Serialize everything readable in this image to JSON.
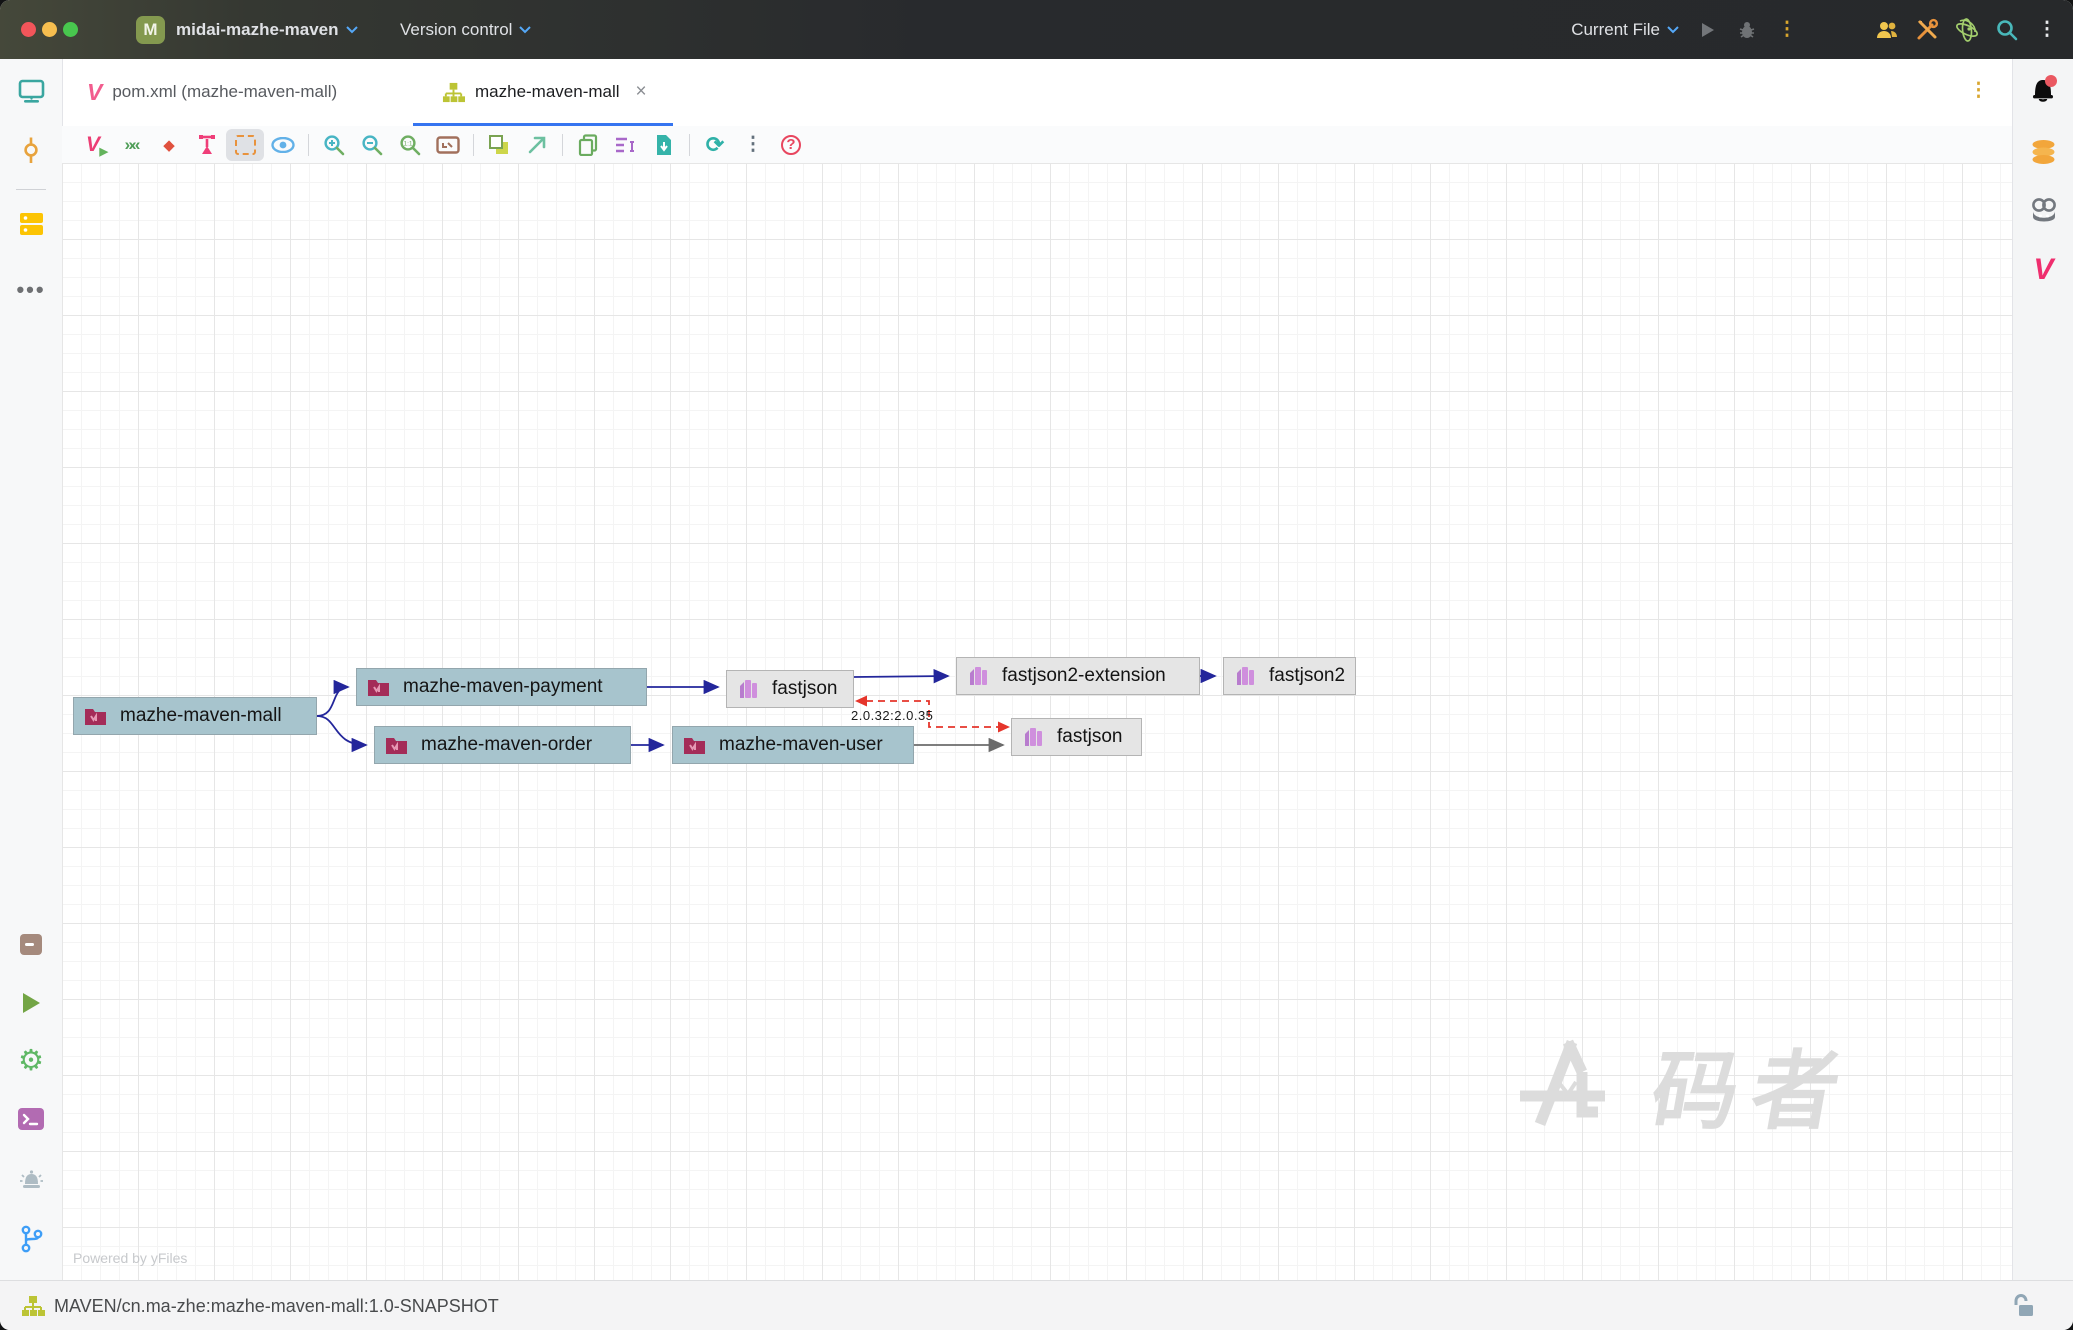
{
  "titlebar": {
    "project_initial": "M",
    "project_name": "midai-mazhe-maven",
    "vcs_label": "Version control",
    "run_config_label": "Current File",
    "icons": [
      "play-icon",
      "debug-bug-icon",
      "more-kebab-icon",
      "users-icon",
      "tools-icon",
      "atom-plugin-icon",
      "search-icon",
      "kebab-icon"
    ]
  },
  "tabs": [
    {
      "label": "pom.xml (mazhe-maven-mall)",
      "icon": "maven-v-icon",
      "active": false
    },
    {
      "label": "mazhe-maven-mall",
      "icon": "module-graph-icon",
      "active": true,
      "close": "×"
    }
  ],
  "toolbar_icons": [
    "maven-reimport-icon",
    "collapse-all-icon",
    "diamond-icon",
    "pin-layout-icon",
    "grid-snap-icon",
    "visibility-eye-icon",
    "zoom-in-icon",
    "zoom-out-icon",
    "zoom-reset-icon",
    "fit-content-icon",
    "layers-icon",
    "open-in-new-icon",
    "copy-icon",
    "edit-properties-icon",
    "export-file-icon",
    "refresh-icon",
    "more-kebab-icon",
    "help-icon"
  ],
  "left_sidebar_icons": [
    "monitor-icon",
    "commit-icon",
    "services-icon",
    "more-icon",
    "package-icon",
    "run-icon",
    "settings-gear-icon",
    "terminal-icon",
    "alarm-icon",
    "git-branch-icon"
  ],
  "right_sidebar_icons": [
    "notifications-bell-icon",
    "database-icon",
    "ai-robot-icon",
    "maven-v-icon"
  ],
  "graph": {
    "nodes": [
      {
        "label": "mazhe-maven-mall",
        "type": "module"
      },
      {
        "label": "mazhe-maven-payment",
        "type": "module"
      },
      {
        "label": "mazhe-maven-order",
        "type": "module"
      },
      {
        "label": "fastjson",
        "type": "library"
      },
      {
        "label": "mazhe-maven-user",
        "type": "module"
      },
      {
        "label": "fastjson2-extension",
        "type": "library"
      },
      {
        "label": "fastjson2",
        "type": "library"
      },
      {
        "label": "fastjson",
        "type": "library"
      }
    ],
    "conflict_label": "2.0.32:2.0.35"
  },
  "canvas": {
    "powered_by": "Powered by yFiles",
    "watermark": "码者"
  },
  "statusbar": {
    "text": "MAVEN/cn.ma-zhe:mazhe-maven-mall:1.0-SNAPSHOT"
  },
  "colors": {
    "accent_blue": "#3574f0",
    "edge_dependency": "#23269b",
    "edge_conflict": "#e5352b",
    "edge_plain": "#6b6b6b",
    "module_node_bg": "#a7c4cd",
    "library_node_bg": "#e5e5e5",
    "titlebar_bg": "#27292b"
  }
}
